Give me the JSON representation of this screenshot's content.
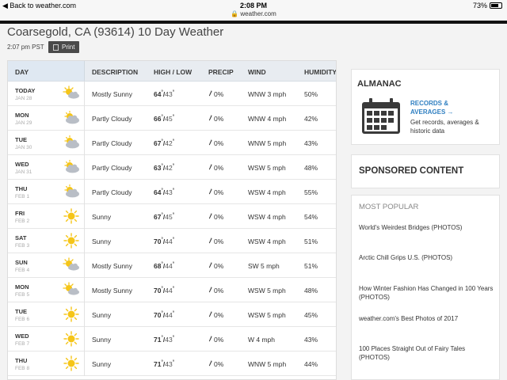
{
  "status_bar": {
    "back_label": "◀ Back to weather.com",
    "time": "2:08 PM",
    "url": "🔒 weather.com",
    "battery": "73%"
  },
  "page": {
    "title": "Coarsegold, CA (93614) 10 Day Weather",
    "timestamp": "2:07 pm PST",
    "print_label": "Print"
  },
  "table": {
    "headers": [
      "DAY",
      "DESCRIPTION",
      "HIGH / LOW",
      "PRECIP",
      "WIND",
      "HUMIDITY"
    ],
    "rows": [
      {
        "day": "TODAY",
        "date": "JAN 28",
        "icon": "mostly-sunny-icon",
        "desc": "Mostly Sunny",
        "high": "64",
        "low": "43",
        "precip": "0%",
        "wind": "WNW 3 mph",
        "humidity": "50%"
      },
      {
        "day": "MON",
        "date": "JAN 29",
        "icon": "partly-cloudy-icon",
        "desc": "Partly Cloudy",
        "high": "66",
        "low": "45",
        "precip": "0%",
        "wind": "WNW 4 mph",
        "humidity": "42%"
      },
      {
        "day": "TUE",
        "date": "JAN 30",
        "icon": "partly-cloudy-icon",
        "desc": "Partly Cloudy",
        "high": "67",
        "low": "42",
        "precip": "0%",
        "wind": "WNW 5 mph",
        "humidity": "43%"
      },
      {
        "day": "WED",
        "date": "JAN 31",
        "icon": "partly-cloudy-icon",
        "desc": "Partly Cloudy",
        "high": "63",
        "low": "42",
        "precip": "0%",
        "wind": "WSW 5 mph",
        "humidity": "48%"
      },
      {
        "day": "THU",
        "date": "FEB 1",
        "icon": "partly-cloudy-icon",
        "desc": "Partly Cloudy",
        "high": "64",
        "low": "43",
        "precip": "0%",
        "wind": "WSW 4 mph",
        "humidity": "55%"
      },
      {
        "day": "FRI",
        "date": "FEB 2",
        "icon": "sunny-icon",
        "desc": "Sunny",
        "high": "67",
        "low": "45",
        "precip": "0%",
        "wind": "WSW 4 mph",
        "humidity": "54%"
      },
      {
        "day": "SAT",
        "date": "FEB 3",
        "icon": "sunny-icon",
        "desc": "Sunny",
        "high": "70",
        "low": "44",
        "precip": "0%",
        "wind": "WSW 4 mph",
        "humidity": "51%"
      },
      {
        "day": "SUN",
        "date": "FEB 4",
        "icon": "mostly-sunny-icon",
        "desc": "Mostly Sunny",
        "high": "68",
        "low": "44",
        "precip": "0%",
        "wind": "SW 5 mph",
        "humidity": "51%"
      },
      {
        "day": "MON",
        "date": "FEB 5",
        "icon": "mostly-sunny-icon",
        "desc": "Mostly Sunny",
        "high": "70",
        "low": "44",
        "precip": "0%",
        "wind": "WSW 5 mph",
        "humidity": "48%"
      },
      {
        "day": "TUE",
        "date": "FEB 6",
        "icon": "sunny-icon",
        "desc": "Sunny",
        "high": "70",
        "low": "44",
        "precip": "0%",
        "wind": "WSW 5 mph",
        "humidity": "45%"
      },
      {
        "day": "WED",
        "date": "FEB 7",
        "icon": "sunny-icon",
        "desc": "Sunny",
        "high": "71",
        "low": "43",
        "precip": "0%",
        "wind": "W 4 mph",
        "humidity": "43%"
      },
      {
        "day": "THU",
        "date": "FEB 8",
        "icon": "sunny-icon",
        "desc": "Sunny",
        "high": "71",
        "low": "43",
        "precip": "0%",
        "wind": "WNW 5 mph",
        "humidity": "44%"
      }
    ]
  },
  "almanac": {
    "title": "ALMANAC",
    "link": "RECORDS & AVERAGES →",
    "description": "Get records, averages & historic data"
  },
  "sponsored": {
    "title": "SPONSORED CONTENT"
  },
  "most_popular": {
    "title": "MOST POPULAR",
    "items": [
      "World's Weirdest Bridges (PHOTOS)",
      "Arctic Chill Grips U.S. (PHOTOS)",
      "How Winter Fashion Has Changed in 100 Years (PHOTOS)",
      "weather.com's Best Photos of 2017",
      "100 Places Straight Out of Fairy Tales (PHOTOS)"
    ]
  },
  "colors": {
    "sun": "#f5c518",
    "cloud": "#b9bec6",
    "link": "#2f7fc1",
    "header_bg": "#e8ecf1"
  }
}
